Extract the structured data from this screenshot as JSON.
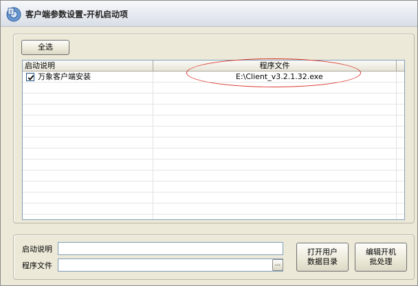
{
  "window": {
    "title": "客户端参数设置-开机启动项"
  },
  "toolbar": {
    "select_all_label": "全选"
  },
  "grid": {
    "columns": [
      "启动说明",
      "程序文件"
    ],
    "rows": [
      {
        "checked": true,
        "description": "万象客户端安装",
        "program": "E:\\Client_v3.2.1.32.exe"
      }
    ]
  },
  "form": {
    "description_label": "启动说明",
    "description_value": "",
    "program_label": "程序文件",
    "program_value": "",
    "browse_label": "...",
    "open_user_data_label": "打开用户数据目录",
    "edit_batch_label": "编辑开机批处理"
  },
  "colors": {
    "highlight_oval": "#d9352a",
    "window_bg": "#ece9d8"
  }
}
